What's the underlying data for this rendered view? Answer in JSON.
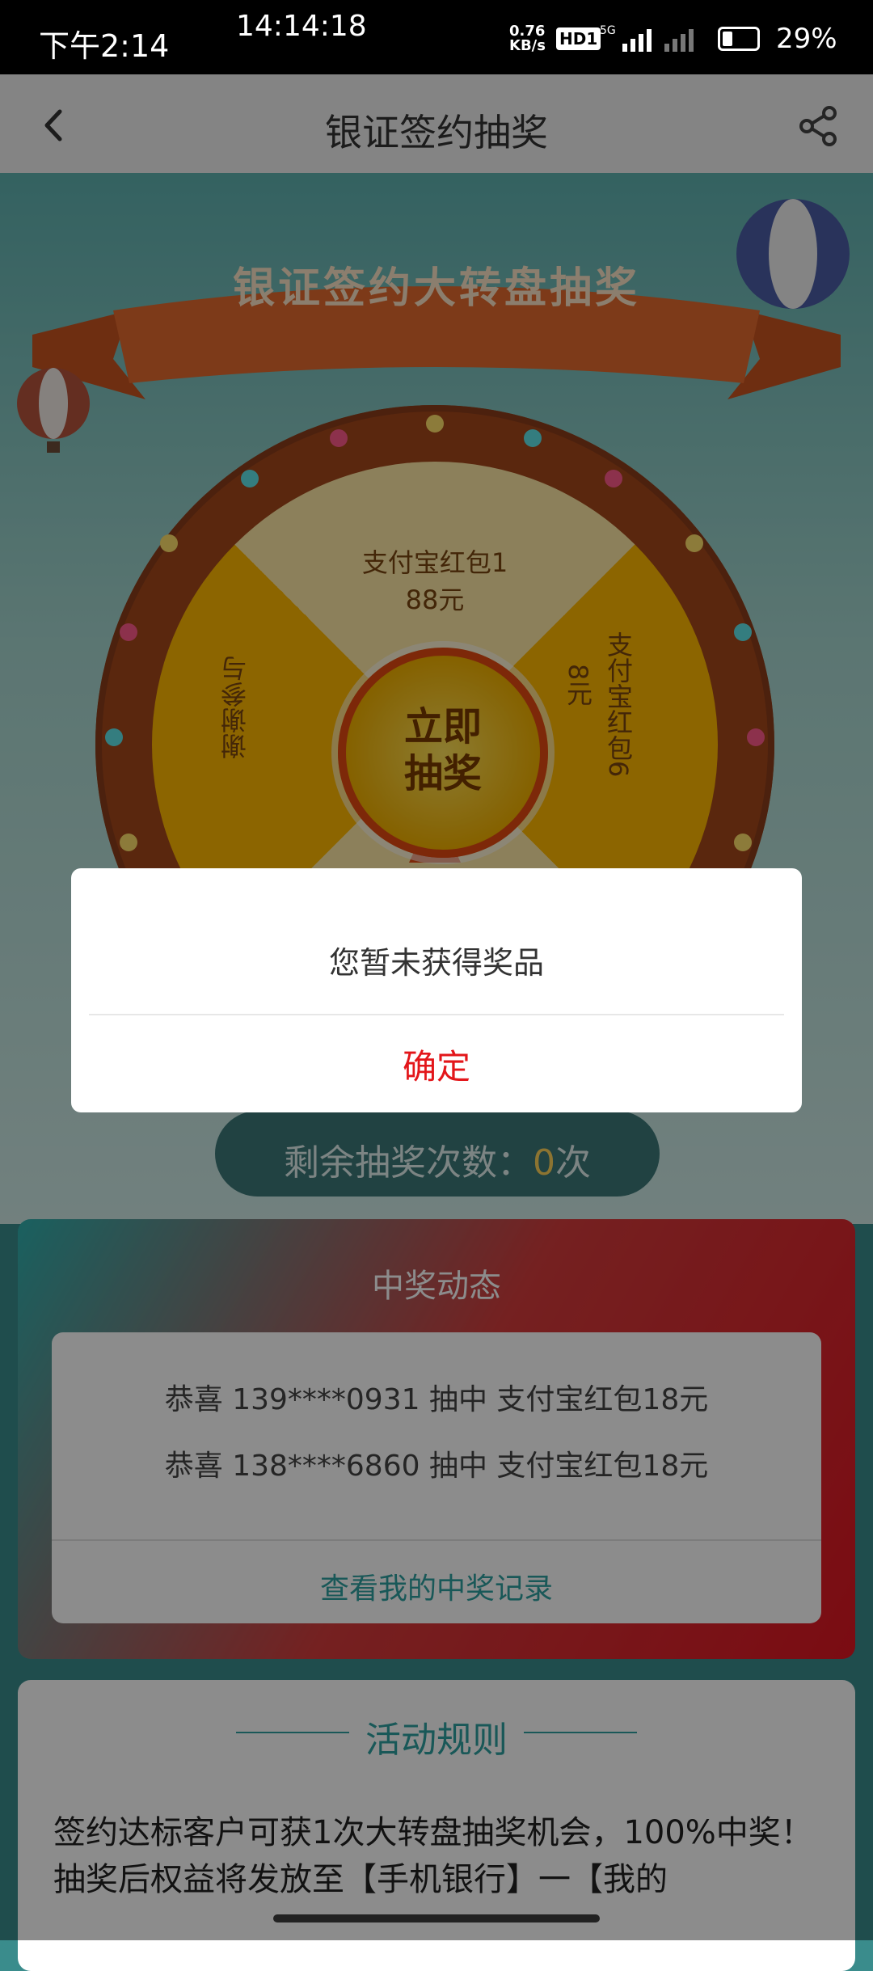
{
  "status_bar": {
    "time_left": "下午2:14",
    "time_center": "14:14:18",
    "net_speed_value": "0.76",
    "net_speed_unit": "KB/s",
    "hd_label": "HD1",
    "network": "5G",
    "battery": "29%"
  },
  "header": {
    "title": "银证签约抽奖"
  },
  "banner": {
    "ribbon_title": "银证签约大转盘抽奖",
    "segments": [
      "支付宝红包1",
      "88元",
      "支付宝红包6",
      "8元",
      "谢谢参与"
    ],
    "center_line1": "立即",
    "center_line2": "抽奖",
    "counter_label": "剩余抽奖次数：",
    "counter_value": "0",
    "counter_unit": "次"
  },
  "winners": {
    "title": "中奖动态",
    "rows": [
      "恭喜 139****0931 抽中 支付宝红包18元",
      "恭喜 138****6860 抽中 支付宝红包18元"
    ],
    "link": "查看我的中奖记录"
  },
  "rules": {
    "title": "活动规则",
    "text": "签约达标客户可获1次大转盘抽奖机会，100%中奖！抽奖后权益将发放至【手机银行】一【我的"
  },
  "dialog": {
    "message": "您暂未获得奖品",
    "confirm": "确定"
  },
  "colors": {
    "accent_red": "#e3161a",
    "teal": "#2fa0a0",
    "wheel_gold": "#ffb800"
  },
  "icons": {
    "back": "back-arrow-icon",
    "share": "share-icon"
  }
}
